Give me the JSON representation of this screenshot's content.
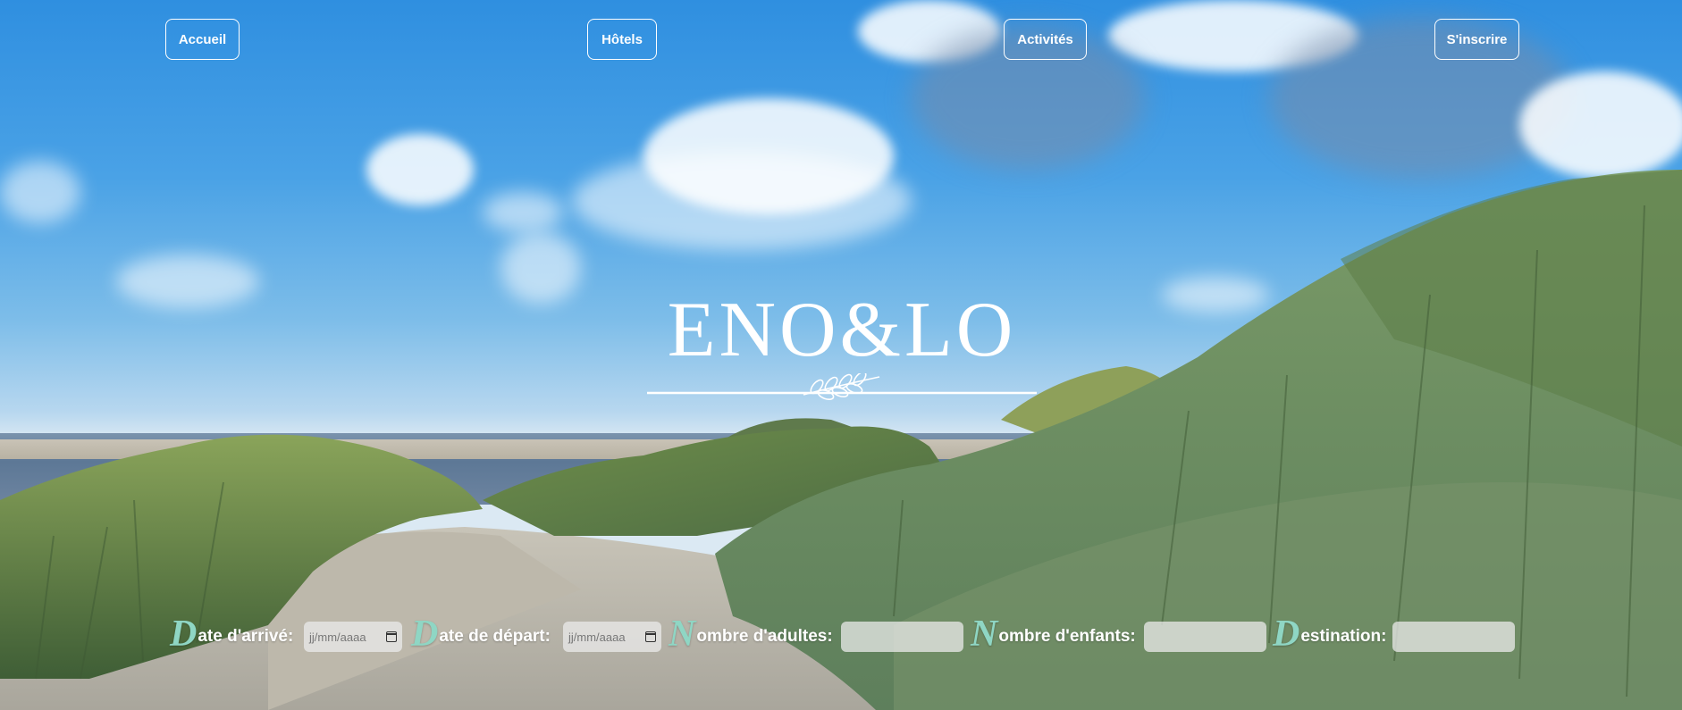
{
  "nav": {
    "home": "Accueil",
    "hotels": "Hôtels",
    "activities": "Activités",
    "signup": "S'inscrire"
  },
  "brand": {
    "title": "ENO&LO"
  },
  "booking": {
    "arrival": {
      "cap": "D",
      "rest": "ate d'arrivé:",
      "placeholder": "jj/mm/aaaa"
    },
    "departure": {
      "cap": "D",
      "rest": "ate de départ:",
      "placeholder": "jj/mm/aaaa"
    },
    "adults": {
      "cap": "N",
      "rest": "ombre d'adultes:",
      "value": ""
    },
    "children": {
      "cap": "N",
      "rest": "ombre d'enfants:",
      "value": ""
    },
    "destination": {
      "cap": "D",
      "rest": "estination:",
      "value": ""
    }
  },
  "colors": {
    "accent_initial": "#8fd6c4",
    "nav_border": "#ffffff",
    "sky_top": "#2f8fe0"
  },
  "icons": [
    "calendar-icon",
    "laurel-icon"
  ]
}
